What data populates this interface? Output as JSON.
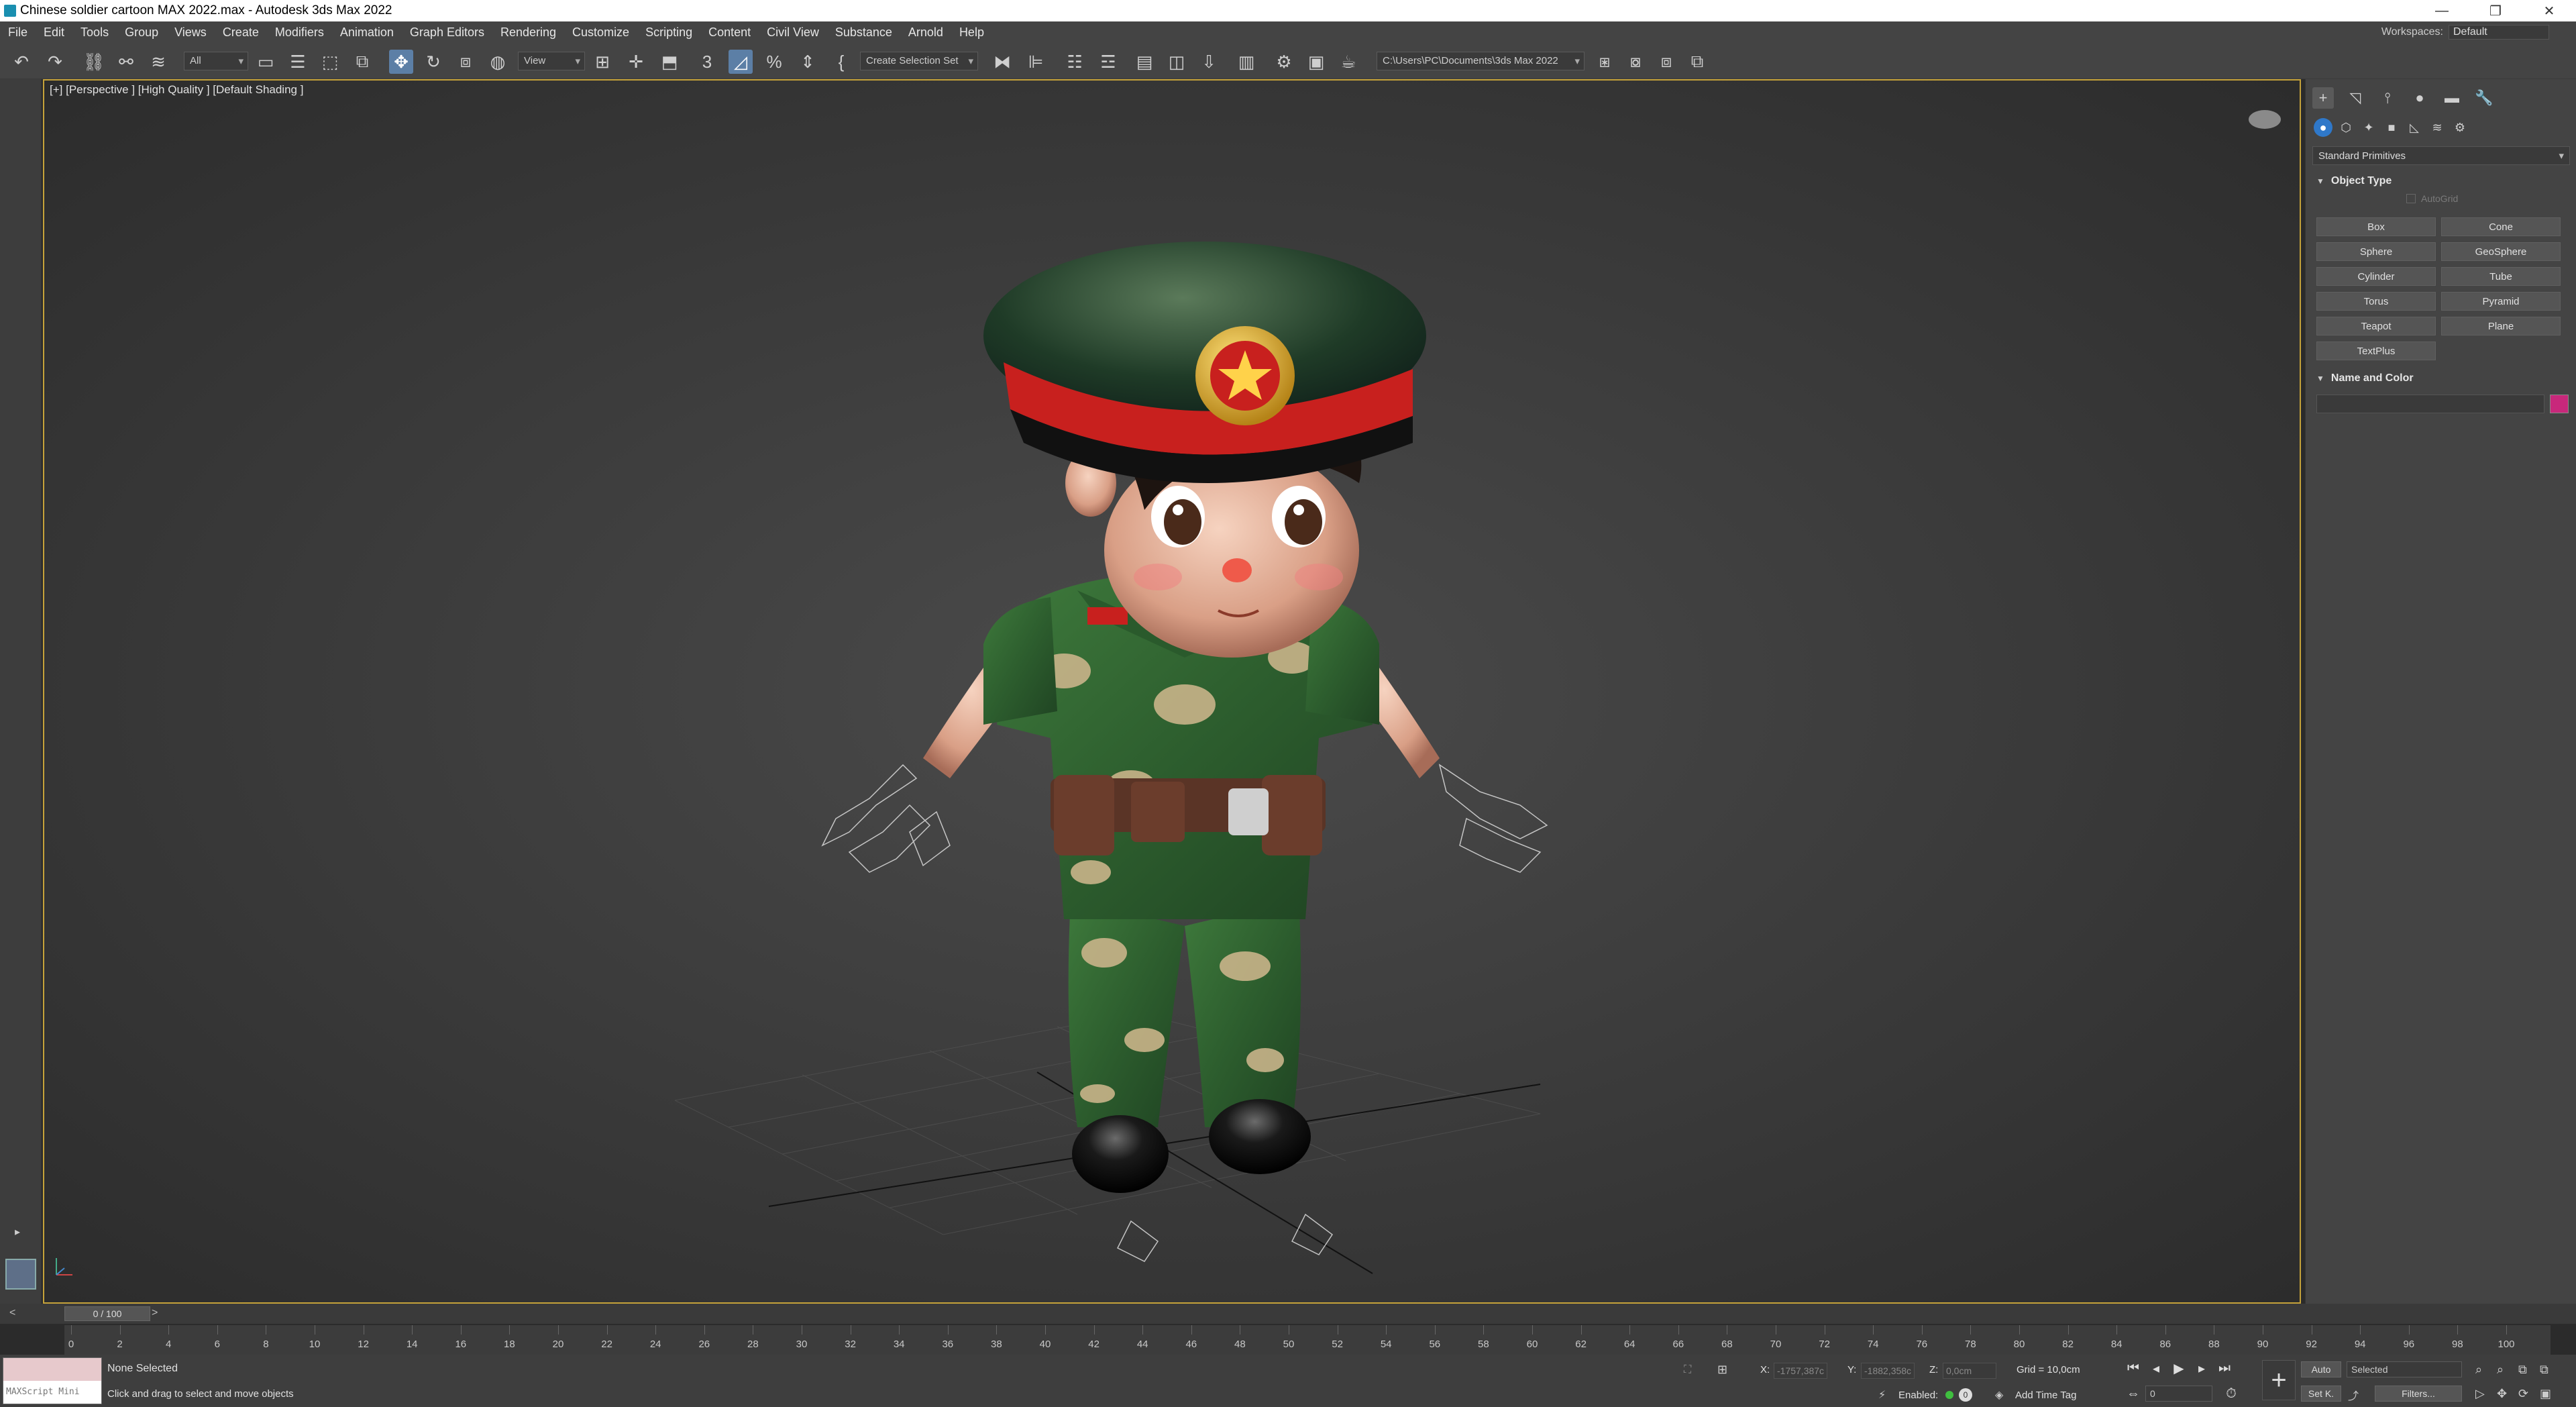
{
  "window": {
    "title": "Chinese soldier cartoon MAX 2022.max - Autodesk 3ds Max 2022",
    "controls": [
      "—",
      "❐",
      "✕"
    ]
  },
  "menu": {
    "items": [
      "File",
      "Edit",
      "Tools",
      "Group",
      "Views",
      "Create",
      "Modifiers",
      "Animation",
      "Graph Editors",
      "Rendering",
      "Customize",
      "Scripting",
      "Content",
      "Civil View",
      "Substance",
      "Arnold",
      "Help"
    ],
    "workspaces_label": "Workspaces:",
    "workspaces_value": "Default"
  },
  "toolbar": {
    "selection_filter": "All",
    "reference_coord": "View",
    "selection_set": "Create Selection Set",
    "project_path": "C:\\Users\\PC\\Documents\\3ds Max 2022"
  },
  "viewport": {
    "label": "[+] [Perspective ] [High Quality ] [Default Shading ]"
  },
  "command_panel": {
    "category": "Standard Primitives",
    "object_type": {
      "title": "Object Type",
      "autogrid": "AutoGrid",
      "buttons": [
        "Box",
        "Cone",
        "Sphere",
        "GeoSphere",
        "Cylinder",
        "Tube",
        "Torus",
        "Pyramid",
        "Teapot",
        "Plane",
        "TextPlus"
      ]
    },
    "name_and_color": {
      "title": "Name and Color",
      "color": "#c8287b"
    }
  },
  "timeline": {
    "slider": "0 / 100",
    "ticks": [
      "0",
      "2",
      "4",
      "6",
      "8",
      "10",
      "12",
      "14",
      "16",
      "18",
      "20",
      "22",
      "24",
      "26",
      "28",
      "30",
      "32",
      "34",
      "36",
      "38",
      "40",
      "42",
      "44",
      "46",
      "48",
      "50",
      "52",
      "54",
      "56",
      "58",
      "60",
      "62",
      "64",
      "66",
      "68",
      "70",
      "72",
      "74",
      "76",
      "78",
      "80",
      "82",
      "84",
      "86",
      "88",
      "90",
      "92",
      "94",
      "96",
      "98",
      "100"
    ]
  },
  "status": {
    "maxscript_placeholder": "MAXScript Mini",
    "selection": "None Selected",
    "prompt": "Click and drag to select and move objects",
    "x_label": "X:",
    "x_value": "-1757,387c",
    "y_label": "Y:",
    "y_value": "-1882,358c",
    "z_label": "Z:",
    "z_value": "0,0cm",
    "grid": "Grid = 10,0cm",
    "enabled": "Enabled:",
    "add_time_tag": "Add Time Tag",
    "auto": "Auto",
    "set_key": "Set K.",
    "key_mode": "Selected",
    "filters": "Filters...",
    "frame": "0"
  }
}
